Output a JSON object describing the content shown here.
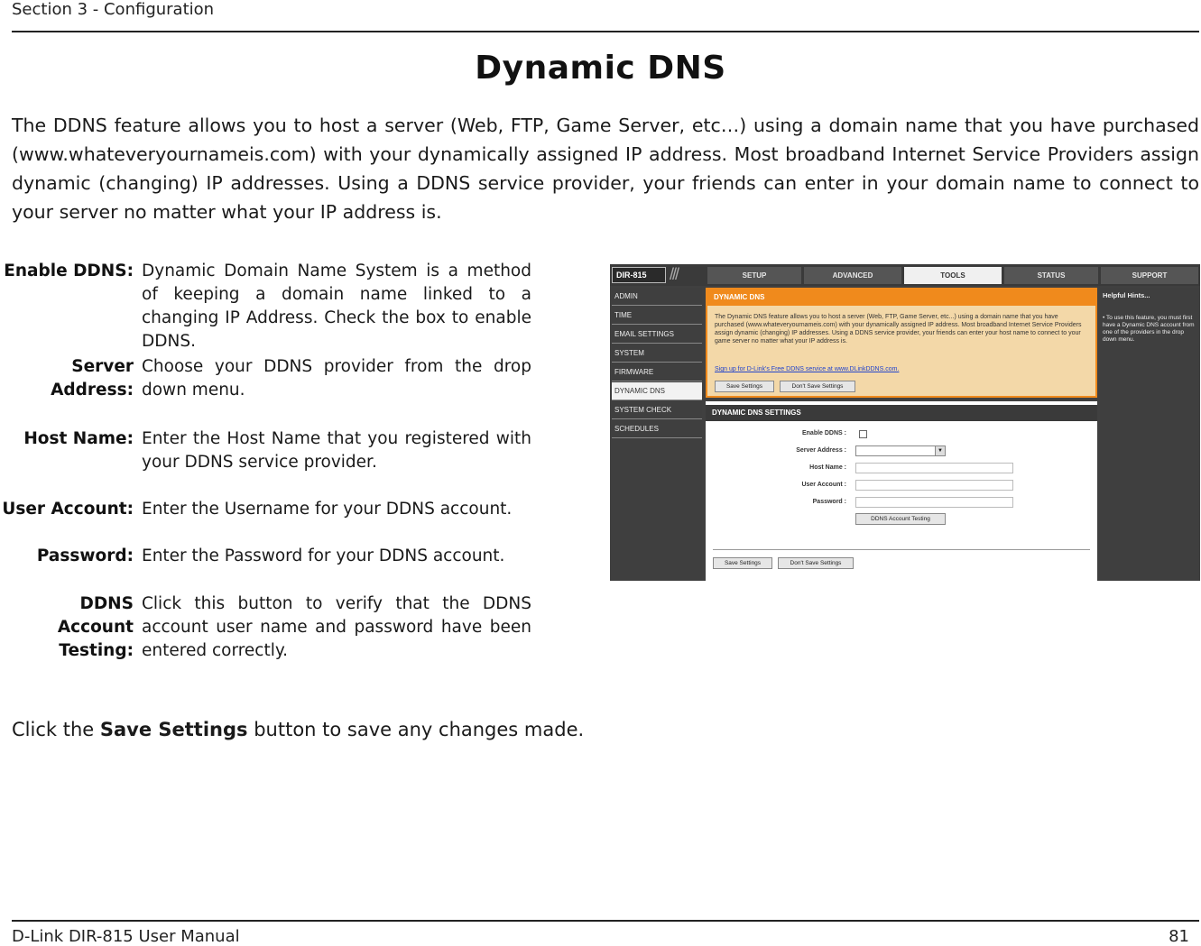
{
  "header": {
    "section": "Section 3 - Configuration"
  },
  "title": "Dynamic DNS",
  "intro": "The DDNS feature allows you to host a server (Web, FTP, Game Server, etc…) using a domain name that you have purchased (www.whateveryournameis.com) with your dynamically assigned IP address. Most broadband Internet Service Providers assign dynamic (changing) IP addresses. Using a DDNS service provider, your friends can enter in your domain name to connect to your server no matter what your IP address is.",
  "definitions": [
    {
      "term": "Enable DDNS:",
      "desc": "Dynamic Domain Name System is a method of keeping a domain name linked to a changing IP Address. Check the box to enable DDNS."
    },
    {
      "term": "Server Address:",
      "desc": "Choose your DDNS provider from the drop down menu."
    },
    {
      "term": "Host Name:",
      "desc": "Enter the Host Name that you registered with your DDNS service provider."
    },
    {
      "term": "User Account:",
      "desc": "Enter the Username for your DDNS account."
    },
    {
      "term": "Password:",
      "desc": "Enter the Password for your DDNS account."
    },
    {
      "term_line1": "DDNS Account",
      "term_line2": "Testing:",
      "desc": "Click this button to verify that the DDNS account user name and password have been entered correctly."
    }
  ],
  "save_note": {
    "prefix": "Click the ",
    "bold": "Save Settings",
    "suffix": " button to save any changes made."
  },
  "footer": {
    "manual": "D-Link DIR-815 User Manual",
    "page": "81"
  },
  "screenshot": {
    "brand": "DIR-815",
    "tabs": [
      "SETUP",
      "ADVANCED",
      "TOOLS",
      "STATUS",
      "SUPPORT"
    ],
    "active_tab": "TOOLS",
    "nav": [
      "ADMIN",
      "TIME",
      "EMAIL SETTINGS",
      "SYSTEM",
      "FIRMWARE",
      "DYNAMIC DNS",
      "SYSTEM CHECK",
      "SCHEDULES"
    ],
    "active_nav": "DYNAMIC DNS",
    "dd_title": "DYNAMIC DNS",
    "dd_text": "The Dynamic DNS feature allows you to host a server (Web, FTP, Game Server, etc...) using a domain name that you have purchased (www.whateveryournameis.com) with your dynamically assigned IP address. Most broadband Internet Service Providers assign dynamic (changing) IP addresses. Using a DDNS service provider, your friends can enter your host name to connect to your game server no matter what your IP address is.",
    "dd_link": "Sign up for D-Link's Free DDNS service at www.DLinkDDNS.com.",
    "save_label": "Save Settings",
    "dont_save_label": "Don't Save Settings",
    "settings_title": "DYNAMIC DNS SETTINGS",
    "fields": {
      "enable": "Enable DDNS :",
      "server": "Server Address :",
      "host": "Host Name :",
      "user": "User Account :",
      "password": "Password :"
    },
    "test_button": "DDNS Account Testing",
    "help_title": "Helpful Hints...",
    "help_text": "• To use this feature, you must first have a Dynamic DNS account from one of the providers in the drop down menu."
  },
  "colors": {
    "accent": "#f08a1c",
    "dark_panel": "#404040"
  }
}
